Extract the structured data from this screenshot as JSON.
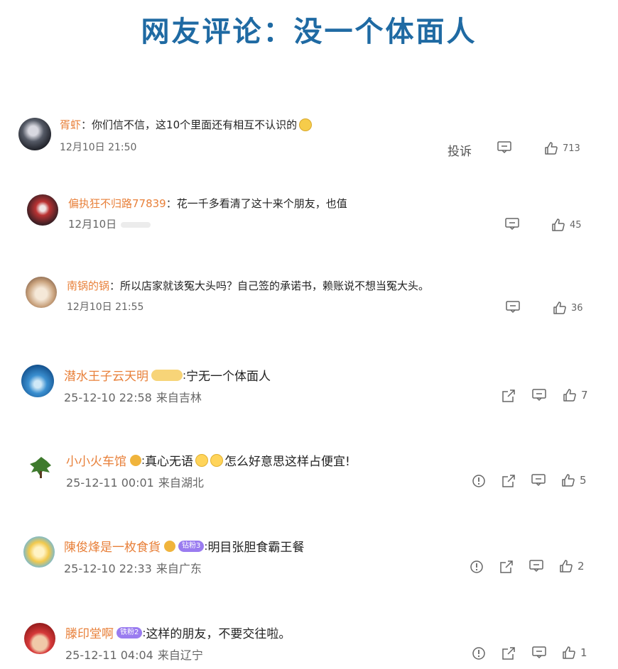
{
  "page": {
    "title": "网友评论：没一个体面人"
  },
  "comments": [
    {
      "name": "胥虾",
      "sep": "：",
      "text": "你们信不信，这10个里面还有相互不认识的",
      "time": "12月10日 21:50",
      "report": "投诉",
      "likes": "713"
    },
    {
      "name": "偏执狂不归路77839",
      "sep": "：",
      "text": "花一千多看清了这十来个朋友，也值",
      "time": "12月10日",
      "likes": "45"
    },
    {
      "name": "南锅的锅",
      "sep": "：",
      "text": "所以店家就该冤大头吗？自己签的承诺书，赖账说不想当冤大头。",
      "time": "12月10日 21:55",
      "likes": "36"
    },
    {
      "name": "潜水王子云天明",
      "sep": ":",
      "text": "宁无一个体面人",
      "time": "25-12-10 22:58",
      "location": "来自吉林",
      "likes": "7"
    },
    {
      "name": "小小火车馆",
      "sep": ":",
      "text": "真心无语",
      "text2": "怎么好意思这样占便宜!",
      "time": "25-12-11 00:01",
      "location": "来自湖北",
      "likes": "5"
    },
    {
      "name": "陳俊烽是一枚食貨",
      "badge": "钻粉3",
      "sep": ":",
      "text": "明目张胆食霸王餐",
      "time": "25-12-10 22:33",
      "location": "来自广东",
      "likes": "2"
    },
    {
      "name": "滕印堂啊",
      "badge": "铁粉2",
      "sep": ":",
      "text": "这样的朋友，不要交往啦。",
      "time": "25-12-11 04:04",
      "location": "来自辽宁",
      "likes": "1"
    }
  ],
  "icons": {
    "comment": "comment-icon",
    "like": "thumbs-up-icon",
    "share": "share-icon",
    "report": "report-icon"
  },
  "colors": {
    "title": "#1f6aa3",
    "username": "#e8803a",
    "meta": "#666666"
  }
}
